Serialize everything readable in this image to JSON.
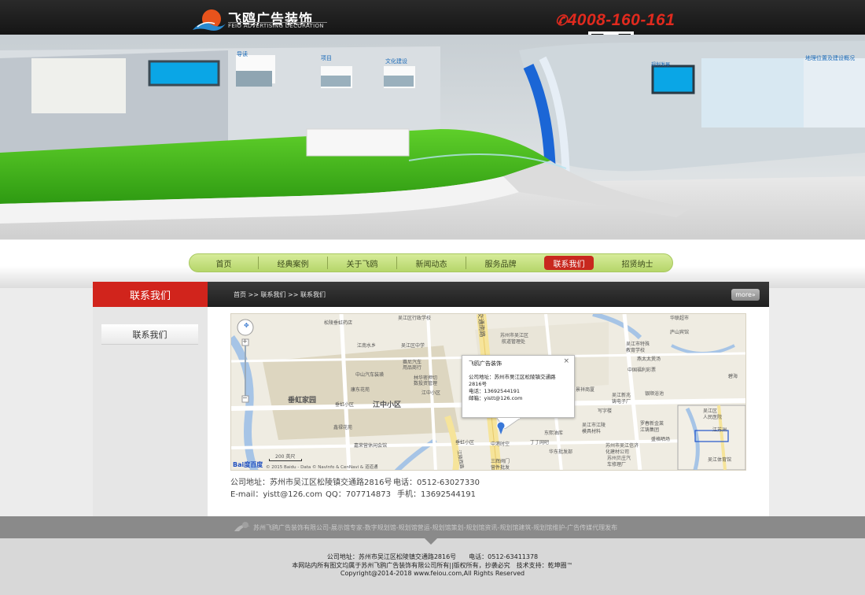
{
  "header": {
    "logo_cn": "飞鸥广告装饰",
    "logo_en": "FEIO ADVERTISING DECORATION",
    "phone": "4008-160-161"
  },
  "banner": {
    "labels": [
      "导读",
      "项目",
      "文化建设",
      "规划发展",
      "地理位置及建设概况"
    ]
  },
  "nav": {
    "items": [
      {
        "label": "首页"
      },
      {
        "label": "经典案例"
      },
      {
        "label": "关于飞鸥"
      },
      {
        "label": "新闻动态"
      },
      {
        "label": "服务品牌"
      },
      {
        "label": "联系我们",
        "active": true
      },
      {
        "label": "招贤纳士"
      }
    ]
  },
  "sidebar": {
    "title": "联系我们",
    "link": "联系我们"
  },
  "breadcrumb": {
    "text": "首页 >> 联系我们 >> 联系我们",
    "more": "more»"
  },
  "map": {
    "labels": {
      "l1": "松陵垂虹药店",
      "l2": "吴江区行政学校",
      "l3": "苏州市吴江区",
      "l4": "航道管理处",
      "l5": "华联超市",
      "l6": "庐山宾馆",
      "l7": "江南水乡",
      "l8": "吴江区中学",
      "l9": "吴江市特殊",
      "l10": "教育学校",
      "l11": "燕太太煲汤",
      "l12": "中山汽车装璜",
      "l13": "赛尼汽车",
      "l14": "用品商行",
      "l15": "中国福利彩票",
      "l16": "林华密押切",
      "l17": "数投资管理",
      "l18": "康东花苑",
      "l19": "江中小区",
      "l20": "银顺浴池",
      "l21": "垂虹小区",
      "l22": "垂虹家园",
      "l23": "江中小区",
      "l24": "鑫禄花苑",
      "l25": "写字楼",
      "l26": "景祥商厦",
      "l27": "吴江新兆",
      "l28": "铸电子厂",
      "l29": "吴江市江陵",
      "l30": "模具材料",
      "l31": "罗春新金莱",
      "l32": "江铸集团",
      "l33": "嘉荣营休闲会馆",
      "l34": "垂虹小区",
      "l35": "东熙油库",
      "l36": "丁丁网吧",
      "l37": "华东批发部",
      "l38": "苏州市吴江信济",
      "l39": "化建材公司",
      "l40": "苏州贝庄汽",
      "l41": "车修理厂",
      "l42": "中港时空",
      "l43": "三辉阀门",
      "l44": "营件批发",
      "l45": "盛格晒场",
      "l46": "碧海",
      "l47": "吴江区",
      "l48": "人民医院",
      "l49": "江苏洲",
      "l50": "吴江体育馆",
      "l51": "江陵西路",
      "l52": "交通南路",
      "scale": "200 英尺",
      "copyright": "© 2015 Baidu - Data © NavInfo & CenNavi & 道道通",
      "baidu": "Bai度百度"
    },
    "popup": {
      "title": "飞鸥广告装饰",
      "address": "公司地址：苏州市吴江区松陵镇交通路2816号",
      "phone": "电话：13692544191",
      "email": "邮箱：yistt@126.com",
      "close": "×"
    }
  },
  "contact": {
    "address": "公司地址：苏州市吴江区松陵镇交通路2816号",
    "tel": "电话：0512-63027330",
    "email": "E-mail：yistt@126.com",
    "qq": "QQ：707714873",
    "mobile": "手机：13692544191"
  },
  "footer": {
    "slogan": "苏州飞鸥广告装饰有限公司-展示馆专家-数字规划馆-规划馆营运-规划馆策划-规划馆资讯-规划馆建筑-规划馆维护-广告传媒代理发布",
    "address": "公司地址：苏州市吴江区松陵镇交通路2816号　　电话：0512-63411378",
    "rights": "本网站内所有图文均属于苏州飞鸥广告装饰有限公司所有||版权所有，抄袭必究　技术支持：乾坤圈™",
    "copyright": "Copyright@2014-2018 www.feiou.com,All Rights Reserved"
  },
  "colors": {
    "accent_red": "#d1241c",
    "nav_green": "#b6d66a",
    "header_dark": "#1c1c1c",
    "phone_red": "#e02a1e"
  }
}
